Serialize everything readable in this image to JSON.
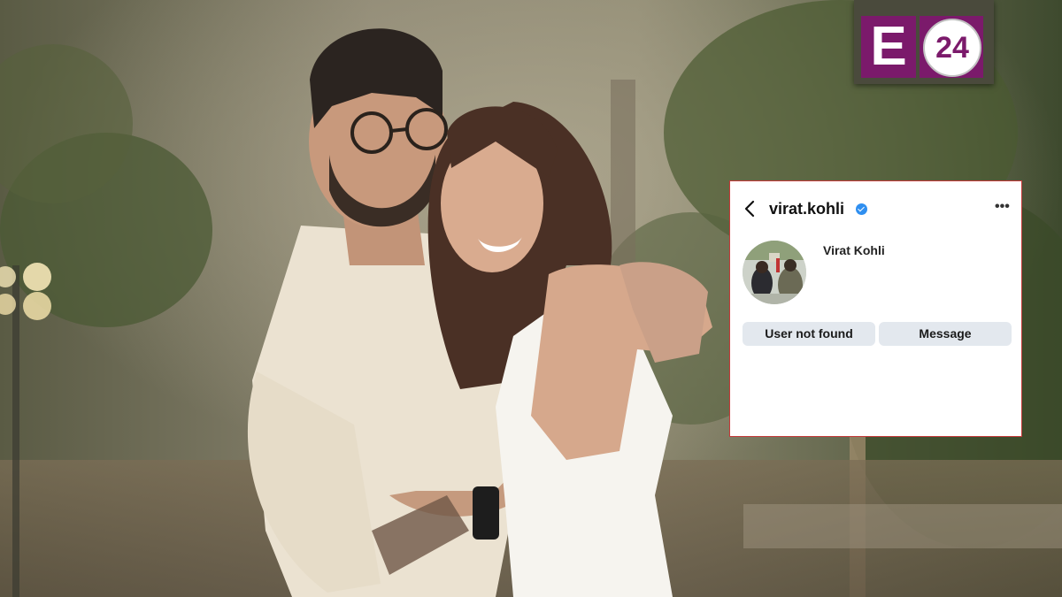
{
  "logo": {
    "letter": "E",
    "number": "24"
  },
  "profile": {
    "username": "virat.kohli",
    "display_name": "Virat Kohli",
    "status_button": "User not found",
    "message_button": "Message",
    "more_label": "•••",
    "accent_color": "#2f8ff0",
    "border_color": "#c53a3a"
  }
}
